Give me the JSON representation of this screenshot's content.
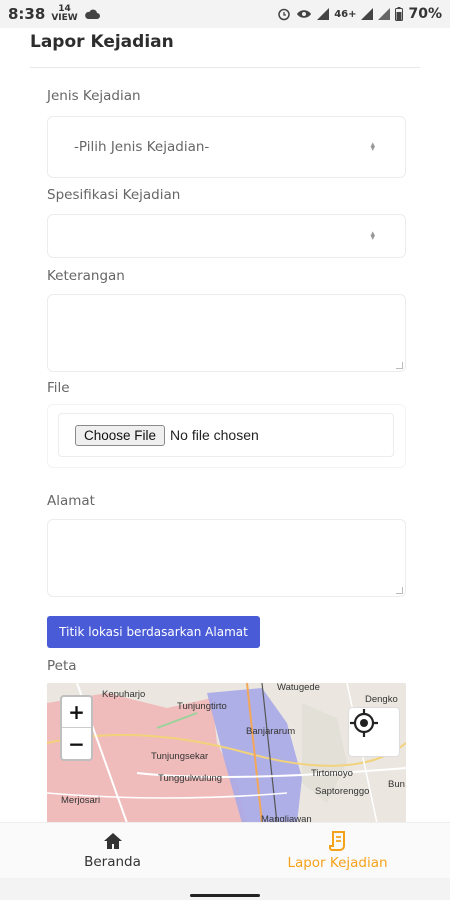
{
  "status_bar": {
    "time": "8:38",
    "notif_top": "14",
    "notif_bottom": "VIEW",
    "network": "46+",
    "battery": "70%"
  },
  "header": {
    "title": "Lapor Kejadian"
  },
  "form": {
    "jenis_label": "Jenis Kejadian",
    "jenis_value": "-Pilih Jenis Kejadian-",
    "spesifikasi_label": "Spesifikasi Kejadian",
    "spesifikasi_value": "",
    "keterangan_label": "Keterangan",
    "file_label": "File",
    "choose_file": "Choose File",
    "no_file": "No file chosen",
    "alamat_label": "Alamat",
    "geocode_button": "Titik lokasi berdasarkan Alamat",
    "peta_label": "Peta"
  },
  "map": {
    "zoom_in": "+",
    "zoom_out": "−",
    "places": {
      "kepuharjo": "Kepuharjo",
      "tungluk": "Tunjungtirto",
      "watugede": "Watugede",
      "dengko": "Dengko",
      "banjararum": "Banjararum",
      "tunjungsekar": "Tunjungsekar",
      "tunggulwulung": "Tunggulwulung",
      "tirtomoyo": "Tirtomoyo",
      "saptorenggo": "Saptorenggo",
      "merjosari": "Merjosari",
      "mangliawan": "Mangliawan",
      "bun": "Bun"
    }
  },
  "bottom_nav": {
    "home_label": "Beranda",
    "report_label": "Lapor Kejadian",
    "active_color": "#f5a21b"
  }
}
